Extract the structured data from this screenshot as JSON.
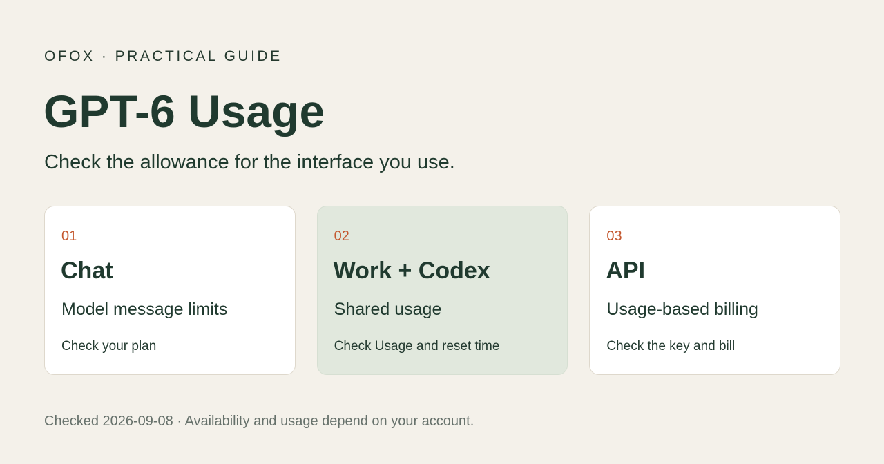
{
  "header": {
    "eyebrow": "OFOX · PRACTICAL GUIDE",
    "title": "GPT-6 Usage",
    "subtitle": "Check the allowance for the interface you use."
  },
  "cards": [
    {
      "number": "01",
      "title": "Chat",
      "subtitle": "Model message limits",
      "note": "Check your plan",
      "highlighted": false
    },
    {
      "number": "02",
      "title": "Work + Codex",
      "subtitle": "Shared usage",
      "note": "Check Usage and reset time",
      "highlighted": true
    },
    {
      "number": "03",
      "title": "API",
      "subtitle": "Usage-based billing",
      "note": "Check the key and bill",
      "highlighted": false
    }
  ],
  "footer": {
    "text": "Checked 2026-09-08 · Availability and usage depend on your account."
  },
  "colors": {
    "background": "#f4f1ea",
    "primary_text": "#203a2f",
    "accent_number": "#c4582f",
    "highlight_card": "#e1e8dd",
    "muted_text": "#66716b"
  }
}
